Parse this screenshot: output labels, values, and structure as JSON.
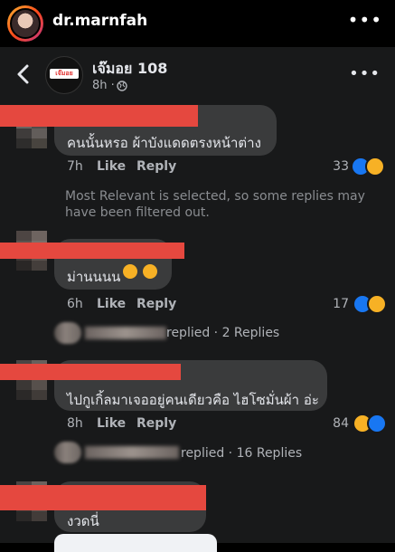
{
  "ig": {
    "username": "dr.marnfah",
    "more": "•••"
  },
  "post": {
    "page_name": "เจ๊มอย 108",
    "time": "8h ·",
    "logo": "เจ๊มอย",
    "more": "•••"
  },
  "comments": [
    {
      "text": "คนนั้นหรอ  ผ้าบังแดดตรงหน้าต่าง",
      "time": "7h",
      "like": "Like",
      "reply": "Reply",
      "count": "33"
    },
    {
      "text": "ม่านนนน",
      "time": "6h",
      "like": "Like",
      "reply": "Reply",
      "count": "17",
      "replies": "replied · 2 Replies"
    },
    {
      "text": "ไปกูเกิ้ลมาเจออยู่คนเดียวคือ ไฮโซมั่นผ้า อ่ะ",
      "time": "8h",
      "like": "Like",
      "reply": "Reply",
      "count": "84",
      "replies": "replied · 16 Replies"
    },
    {
      "text": "งวดนี่"
    }
  ],
  "notice": "Most Relevant is selected, so some replies may have been filtered out.",
  "colors": {
    "redaction": "#e5483f",
    "like": "#1877f2",
    "haha": "#f7b125",
    "bubble": "#3a3b3c"
  }
}
